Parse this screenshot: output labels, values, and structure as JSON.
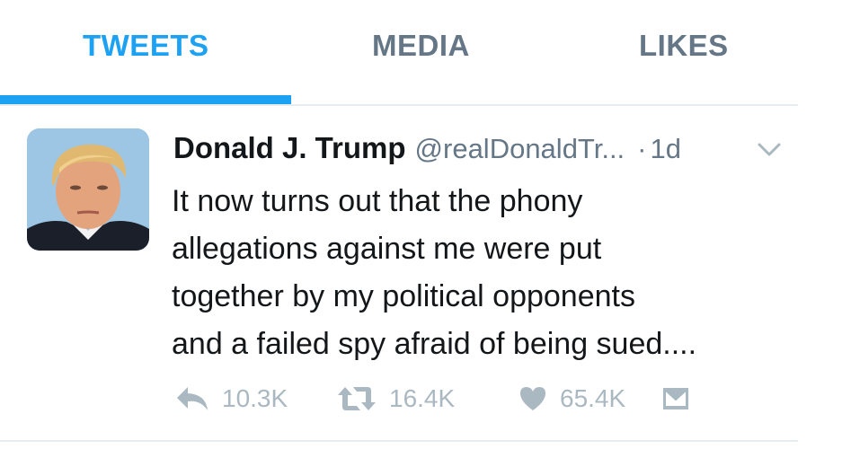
{
  "tabs": {
    "items": [
      {
        "label": "TWEETS",
        "active": true
      },
      {
        "label": "MEDIA",
        "active": false
      },
      {
        "label": "LIKES",
        "active": false
      }
    ]
  },
  "tweet": {
    "author_name": "Donald J. Trump",
    "author_handle": "@realDonaldTr...",
    "separator": "·",
    "time": "1d",
    "text_lines": [
      "It now turns out that the phony",
      "allegations against me were put",
      "together by my political opponents",
      "and a failed spy afraid of being sued...."
    ],
    "actions": {
      "reply_count": "10.3K",
      "retweet_count": "16.4K",
      "like_count": "65.4K"
    },
    "icons": {
      "menu": "chevron-down-icon",
      "reply": "reply-icon",
      "retweet": "retweet-icon",
      "like": "heart-icon",
      "dm": "envelope-icon"
    }
  },
  "colors": {
    "accent": "#1da1f2",
    "muted_text": "#657786",
    "action_gray": "#aab8c2",
    "primary_text": "#14171a",
    "divider": "#e6ecf0"
  }
}
